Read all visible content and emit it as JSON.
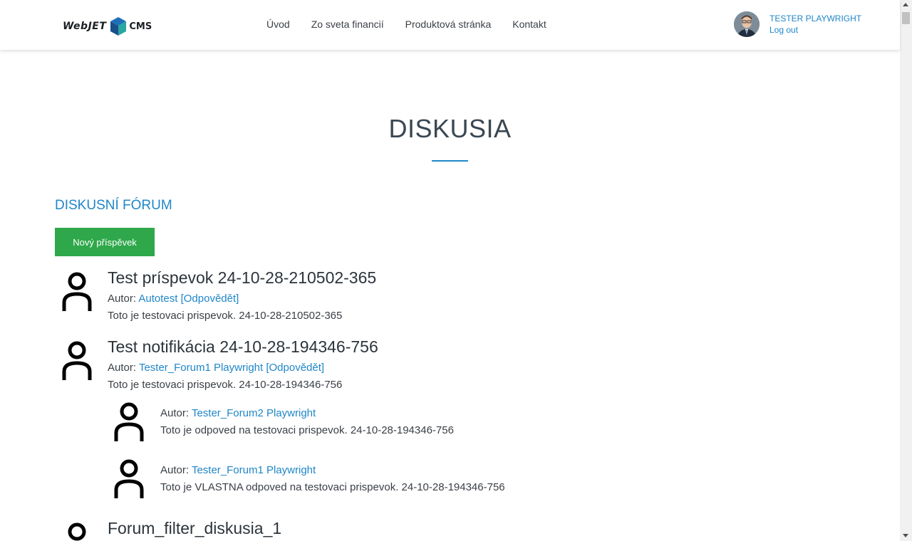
{
  "header": {
    "logo_word": "WebJET",
    "logo_cms": "CMS",
    "nav": [
      "Úvod",
      "Zo sveta financií",
      "Produktová stránka",
      "Kontakt"
    ],
    "user_name": "TESTER PLAYWRIGHT",
    "logout": "Log out"
  },
  "page": {
    "title": "DISKUSIA",
    "section_title": "DISKUSNÍ FÓRUM",
    "new_post_button": "Nový příspěvek"
  },
  "posts": [
    {
      "title": "Test príspevok 24-10-28-210502-365",
      "author_prefix": "Autor:",
      "author": "Autotest",
      "reply_link": "[Odpovědět]",
      "body": "Toto je testovaci prispevok. 24-10-28-210502-365"
    },
    {
      "title": "Test notifikácia 24-10-28-194346-756",
      "author_prefix": "Autor:",
      "author": "Tester_Forum1 Playwright",
      "reply_link": "[Odpovědět]",
      "body": "Toto je testovaci prispevok. 24-10-28-194346-756",
      "replies": [
        {
          "author_prefix": "Autor:",
          "author": "Tester_Forum2 Playwright",
          "body": "Toto je odpoved na testovaci prispevok. 24-10-28-194346-756"
        },
        {
          "author_prefix": "Autor:",
          "author": "Tester_Forum1 Playwright",
          "body": "Toto je VLASTNA odpoved na testovaci prispevok. 24-10-28-194346-756"
        }
      ]
    },
    {
      "title": "Forum_filter_diskusia_1"
    }
  ],
  "colors": {
    "accent": "#1f86c8",
    "button_green": "#2ea84a",
    "text": "#3a3f45"
  }
}
